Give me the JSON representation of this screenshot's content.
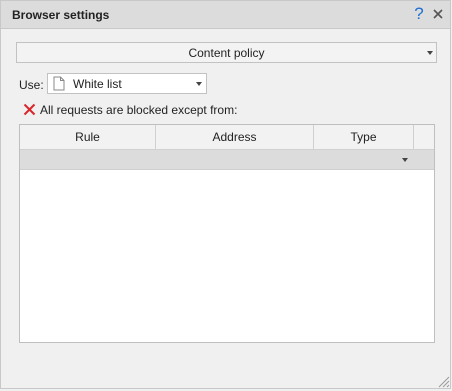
{
  "window": {
    "title": "Browser settings",
    "help_icon": "help-icon",
    "close_icon": "close-icon"
  },
  "policy": {
    "selected": "Content policy"
  },
  "use": {
    "label": "Use:",
    "selected": "White list",
    "icon": "document-icon"
  },
  "status": {
    "icon": "red-x-icon",
    "text": "All requests are blocked except from:",
    "color": "#d9262a"
  },
  "table": {
    "columns": [
      "Rule",
      "Address",
      "Type"
    ],
    "rows": []
  },
  "colors": {
    "accent": "#1e6fd6",
    "titlebar": "#dcdcdc",
    "background": "#f0f0f0"
  }
}
